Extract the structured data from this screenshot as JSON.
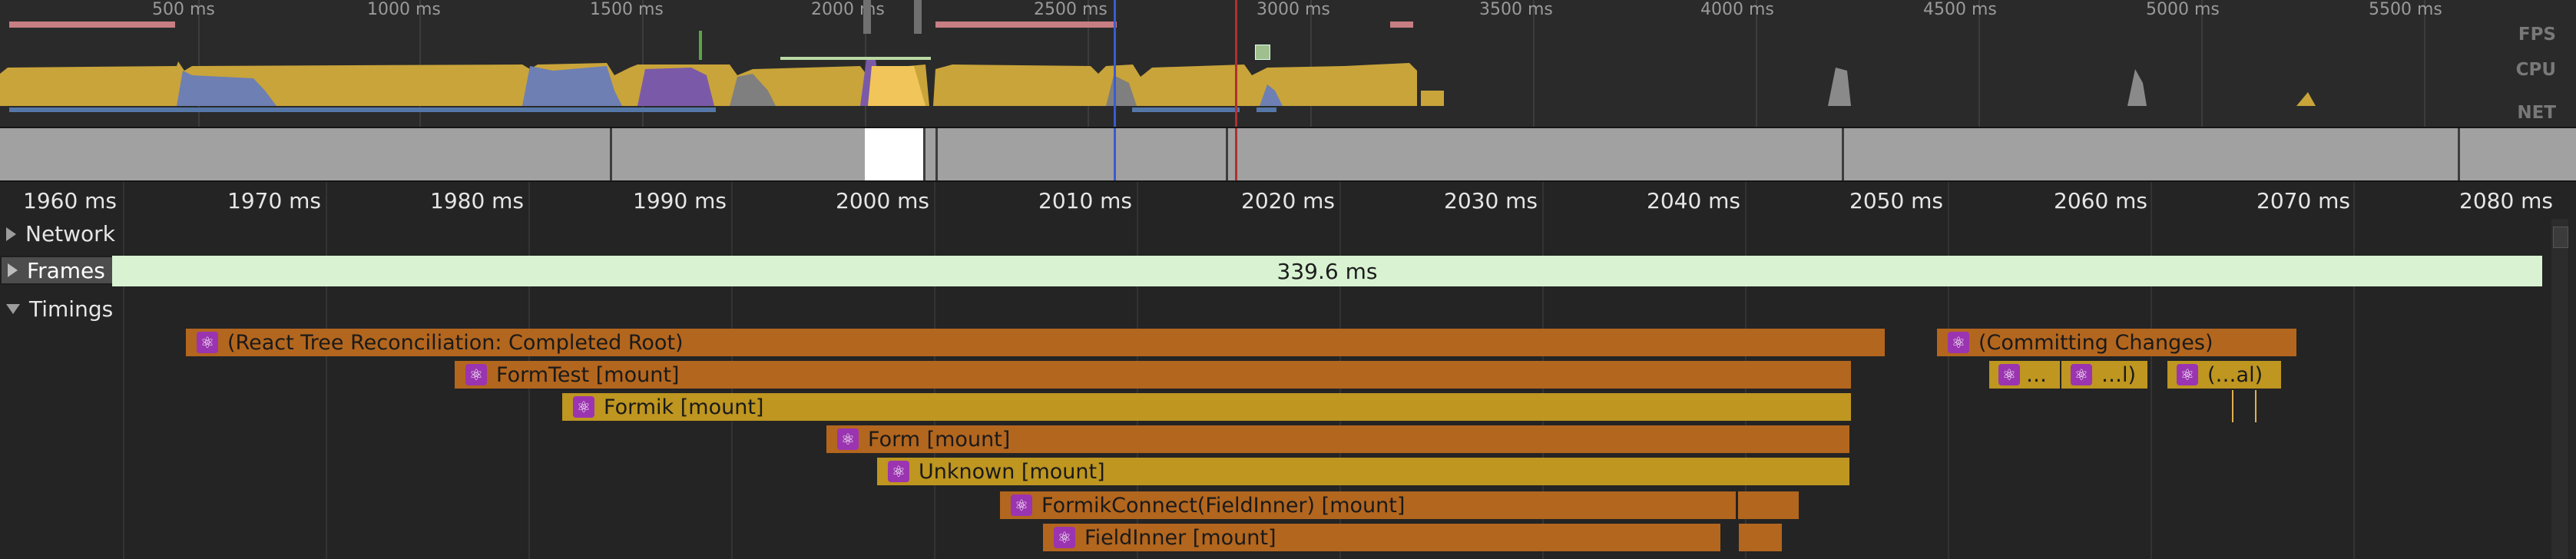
{
  "overview": {
    "ticks": [
      "500 ms",
      "1000 ms",
      "1500 ms",
      "2000 ms",
      "2500 ms",
      "3000 ms",
      "3500 ms",
      "4000 ms",
      "4500 ms",
      "5000 ms",
      "5500 ms"
    ],
    "rows": [
      "FPS",
      "CPU",
      "NET"
    ]
  },
  "ruler": {
    "ticks": [
      "1960 ms",
      "1970 ms",
      "1980 ms",
      "1990 ms",
      "2000 ms",
      "2010 ms",
      "2020 ms",
      "2030 ms",
      "2040 ms",
      "2050 ms",
      "2060 ms",
      "2070 ms",
      "2080 ms"
    ]
  },
  "tracks": {
    "network": "Network",
    "frames": "Frames",
    "frames_value": "339.6 ms",
    "timings": "Timings"
  },
  "timings": [
    {
      "label": "(React Tree Reconciliation: Completed Root)",
      "color": "orange"
    },
    {
      "label": "(Committing Changes)",
      "color": "orange"
    },
    {
      "label": "FormTest [mount]",
      "color": "orange"
    },
    {
      "label": "…",
      "color": "yellow"
    },
    {
      "label": "…l)",
      "color": "yellow"
    },
    {
      "label": "(…al)",
      "color": "yellow"
    },
    {
      "label": "Formik [mount]",
      "color": "yellow"
    },
    {
      "label": "Form [mount]",
      "color": "orange"
    },
    {
      "label": "Unknown [mount]",
      "color": "yellow"
    },
    {
      "label": "FormikConnect(FieldInner) [mount]",
      "color": "orange"
    },
    {
      "label": "FieldInner [mount]",
      "color": "orange"
    }
  ],
  "colors": {
    "background": "#242424",
    "frames_bar": "#d9f2d2",
    "timing_orange": "#b3661e",
    "timing_yellow": "#be9620",
    "react_icon": "#9b34b0",
    "cpu_scripting": "#c9a43a",
    "cpu_rendering": "#6d7fb3",
    "cpu_painting": "#7a5aa8"
  },
  "icons": {
    "timing_icon": "react-icon"
  }
}
